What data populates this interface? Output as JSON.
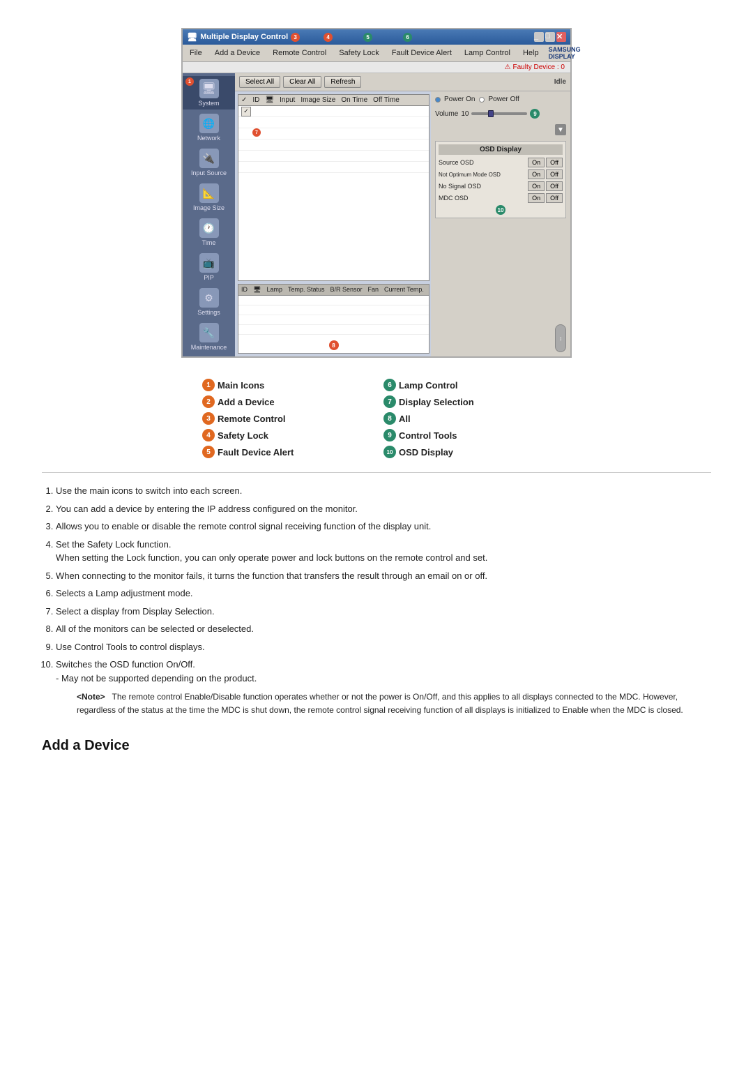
{
  "window": {
    "title": "Multiple Display Control",
    "faulty_device_label": "Faulty Device : 0",
    "samsung_logo": "SAMSUNG DISPLAY"
  },
  "menu": {
    "items": [
      "File",
      "Add a Device",
      "Remote Control",
      "Safety Lock",
      "Fault Device Alert",
      "Lamp Control",
      "Help"
    ]
  },
  "toolbar": {
    "select_all": "Select All",
    "clear_all": "Clear All",
    "refresh": "Refresh",
    "idle": "Idle"
  },
  "table_top": {
    "columns": [
      "✓",
      "ID",
      "🖥",
      "Input",
      "Image Size",
      "On Time",
      "Off Time"
    ]
  },
  "table_bottom": {
    "columns": [
      "ID",
      "🖥",
      "Lamp",
      "Temp. Status",
      "B/R Sensor",
      "Fan",
      "Current Temp."
    ]
  },
  "controls": {
    "power_on": "Power On",
    "power_off": "Power Off",
    "volume_label": "Volume",
    "volume_value": "10",
    "osd_display_title": "OSD Display",
    "osd_rows": [
      {
        "label": "Source OSD",
        "on": "On",
        "off": "Off"
      },
      {
        "label": "Not Optimum Mode OSD",
        "on": "On",
        "off": "Off"
      },
      {
        "label": "No Signal OSD",
        "on": "On",
        "off": "Off"
      },
      {
        "label": "MDC OSD",
        "on": "On",
        "off": "Off"
      }
    ]
  },
  "sidebar": {
    "items": [
      {
        "label": "System",
        "badge": "1"
      },
      {
        "label": "Network"
      },
      {
        "label": "Input Source"
      },
      {
        "label": "Image Size"
      },
      {
        "label": "Time"
      },
      {
        "label": "PIP"
      },
      {
        "label": "Settings"
      },
      {
        "label": "Maintenance"
      }
    ]
  },
  "legend": {
    "left": [
      {
        "num": "1",
        "label": "Main Icons"
      },
      {
        "num": "2",
        "label": "Add a Device"
      },
      {
        "num": "3",
        "label": "Remote Control"
      },
      {
        "num": "4",
        "label": "Safety Lock"
      },
      {
        "num": "5",
        "label": "Fault Device Alert"
      }
    ],
    "right": [
      {
        "num": "6",
        "label": "Lamp Control"
      },
      {
        "num": "7",
        "label": "Display Selection"
      },
      {
        "num": "8",
        "label": "All"
      },
      {
        "num": "9",
        "label": "Control Tools"
      },
      {
        "num": "10",
        "label": "OSD Display"
      }
    ]
  },
  "numbered_list": [
    "Use the main icons to switch into each screen.",
    "You can add a device by entering the IP address configured on the monitor.",
    "Allows you to enable or disable the remote control signal receiving function of the display unit.",
    "Set the Safety Lock function.\nWhen setting the Lock function, you can only operate power and lock buttons on the remote control and set.",
    "When connecting to the monitor fails, it turns the function that transfers the result through an email on or off.",
    "Selects a Lamp adjustment mode.",
    "Select a display from Display Selection.",
    "All of the monitors can be selected or deselected.",
    "Use Control Tools to control displays.",
    "Switches the OSD function On/Off.\n- May not be supported depending on the product."
  ],
  "note": {
    "label": "<Note>",
    "text": "The remote control Enable/Disable function operates whether or not the power is On/Off, and this applies to all displays connected to the MDC. However, regardless of the status at the time the MDC is shut down, the remote control signal receiving function of all displays is initialized to Enable when the MDC is closed."
  },
  "section_heading": "Add a Device",
  "colors": {
    "orange": "#e06820",
    "teal": "#2a8a6a"
  }
}
